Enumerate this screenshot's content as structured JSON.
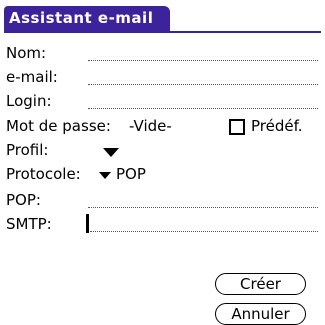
{
  "form": {
    "title": "Assistant e-mail",
    "fields": {
      "nom": {
        "label": "Nom:",
        "value": ""
      },
      "email": {
        "label": "e-mail:",
        "value": ""
      },
      "login": {
        "label": "Login:",
        "value": ""
      },
      "password": {
        "label": "Mot de passe:",
        "value": "-Vide-",
        "predef_label": "Prédéf.",
        "predef_checked": false
      },
      "profil": {
        "label": "Profil:",
        "value": ""
      },
      "protocole": {
        "label": "Protocole:",
        "value": "POP"
      },
      "pop": {
        "label": "POP:",
        "value": ""
      },
      "smtp": {
        "label": "SMTP:",
        "value": ""
      }
    },
    "buttons": {
      "create": "Créer",
      "cancel": "Annuler"
    }
  }
}
